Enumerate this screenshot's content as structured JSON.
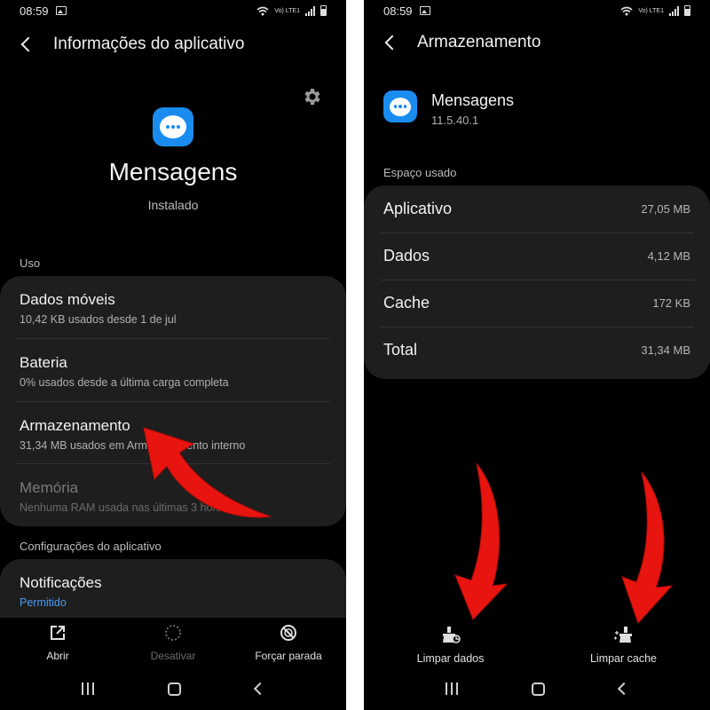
{
  "left": {
    "status": {
      "time": "08:59",
      "lte": "Vo) LTE1"
    },
    "header": {
      "title": "Informações do aplicativo"
    },
    "app": {
      "name": "Mensagens",
      "status": "Instalado"
    },
    "sections": {
      "usage": "Uso",
      "settings": "Configurações do aplicativo"
    },
    "usage_items": [
      {
        "title": "Dados móveis",
        "subtitle": "10,42 KB usados desde 1 de jul"
      },
      {
        "title": "Bateria",
        "subtitle": "0% usados desde a última carga completa"
      },
      {
        "title": "Armazenamento",
        "subtitle": "31,34 MB usados em Armazenamento interno"
      },
      {
        "title": "Memória",
        "subtitle": "Nenhuma RAM usada nas últimas 3 horas"
      }
    ],
    "notifications": {
      "title": "Notificações",
      "subtitle": "Permitido"
    },
    "actions": {
      "open": "Abrir",
      "disable": "Desativar",
      "force_stop": "Forçar parada"
    }
  },
  "right": {
    "status": {
      "time": "08:59",
      "lte": "Vo) LTE1"
    },
    "header": {
      "title": "Armazenamento"
    },
    "app": {
      "name": "Mensagens",
      "version": "11.5.40.1"
    },
    "section": "Espaço usado",
    "storage": [
      {
        "label": "Aplicativo",
        "value": "27,05 MB"
      },
      {
        "label": "Dados",
        "value": "4,12 MB"
      },
      {
        "label": "Cache",
        "value": "172 KB"
      },
      {
        "label": "Total",
        "value": "31,34 MB"
      }
    ],
    "actions": {
      "clear_data": "Limpar dados",
      "clear_cache": "Limpar cache"
    }
  },
  "colors": {
    "accent": "#1a8cf0",
    "link": "#4a9cf5",
    "arrow": "#e8140f",
    "card": "#1e1e1e"
  }
}
